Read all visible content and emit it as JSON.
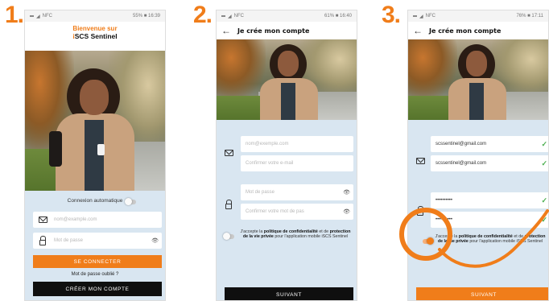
{
  "steps": [
    "1.",
    "2.",
    "3."
  ],
  "colors": {
    "accent": "#f07d1a",
    "form_bg": "#d9e6f1",
    "check": "#4caf50",
    "dark_button": "#0f0f0f"
  },
  "screen1": {
    "status_right": "55% ■ 16:39",
    "welcome_line1": "Bienvenue sur",
    "brand_i": "i",
    "brand_rest": "SCS Sentinel",
    "auto_connect_label": "Connexion automatique",
    "email_placeholder": "nom@example.com",
    "password_placeholder": "Mot de passe",
    "login_button": "SE CONNECTER",
    "forgot_link": "Mot de passe oublié ?",
    "create_account_button": "CRÉER MON COMPTE",
    "icons": {
      "email": "envelope-icon",
      "password": "lock-icon",
      "show_password": "eye-icon"
    }
  },
  "screen2": {
    "status_right": "61% ■ 16:40",
    "title": "Je crée mon compte",
    "email_placeholder": "nom@exemple.com",
    "confirm_email_placeholder": "Confirmer votre e-mail",
    "password_placeholder": "Mot de passe",
    "confirm_password_placeholder": "Confirmer votre mot de pas",
    "consent_prefix": "J'accepte la ",
    "consent_policy": "politique de confidentialité",
    "consent_mid": " et de ",
    "consent_privacy": "protection de la vie privée",
    "consent_suffix": " pour l'application mobile iSCS Sentinel",
    "next_button": "SUIVANT",
    "icons": {
      "back": "back-arrow-icon",
      "email": "envelope-icon",
      "password": "lock-icon",
      "show_password": "eye-icon"
    }
  },
  "screen3": {
    "status_right": "76% ■ 17:11",
    "title": "Je crée mon compte",
    "email_value": "scssentinel@gmail.com",
    "confirm_email_value": "scssentinel@gmail.com",
    "password_value": "••••••••••",
    "confirm_password_value": "••••••••••",
    "consent_prefix": "J'accepte la ",
    "consent_policy": "politique de confidentialité",
    "consent_mid": " et de ",
    "consent_privacy": "protection de la vie privée",
    "consent_suffix": " pour l'application mobile iSCS Sentinel",
    "next_button": "SUIVANT",
    "consent_toggle_on": true,
    "icons": {
      "back": "back-arrow-icon",
      "check": "check-icon",
      "email": "envelope-icon",
      "password": "lock-icon"
    }
  }
}
